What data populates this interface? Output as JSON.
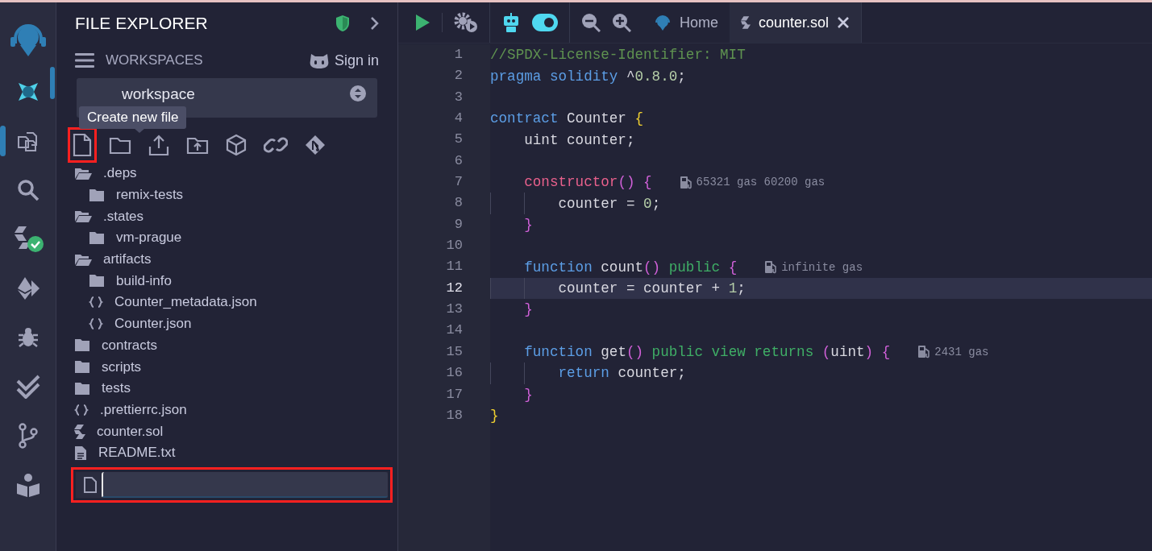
{
  "activity_bar": {
    "items": [
      {
        "kind": "logo",
        "selected": false
      },
      {
        "kind": "ai",
        "selected": false
      },
      {
        "kind": "files",
        "selected": true
      },
      {
        "kind": "search",
        "selected": false
      },
      {
        "kind": "compiler",
        "selected": false
      },
      {
        "kind": "deploy",
        "selected": false
      },
      {
        "kind": "debug",
        "selected": false
      },
      {
        "kind": "tests",
        "selected": false
      },
      {
        "kind": "git",
        "selected": false
      },
      {
        "kind": "learn",
        "selected": false
      }
    ]
  },
  "explorer": {
    "title": "FILE EXPLORER",
    "workspaces_label": "WORKSPACES",
    "sign_in": "Sign in",
    "workspace_select": {
      "value": "workspace"
    },
    "tooltip": "Create new file",
    "toolbar": [
      {
        "kind": "new-file",
        "annotated": true
      },
      {
        "kind": "new-folder",
        "annotated": false
      },
      {
        "kind": "upload",
        "annotated": false
      },
      {
        "kind": "upload-folder",
        "annotated": false
      },
      {
        "kind": "ipfs",
        "annotated": false
      },
      {
        "kind": "link",
        "annotated": false
      },
      {
        "kind": "git",
        "annotated": false
      }
    ],
    "tree": [
      {
        "name": ".deps",
        "kind": "folder",
        "expanded": true,
        "children": [
          {
            "name": "remix-tests",
            "kind": "folder",
            "expanded": false
          }
        ]
      },
      {
        "name": ".states",
        "kind": "folder",
        "expanded": true,
        "children": [
          {
            "name": "vm-prague",
            "kind": "folder",
            "expanded": false
          }
        ]
      },
      {
        "name": "artifacts",
        "kind": "folder",
        "expanded": true,
        "children": [
          {
            "name": "build-info",
            "kind": "folder",
            "expanded": false
          },
          {
            "name": "Counter_metadata.json",
            "kind": "json"
          },
          {
            "name": "Counter.json",
            "kind": "json"
          }
        ]
      },
      {
        "name": "contracts",
        "kind": "folder",
        "expanded": false
      },
      {
        "name": "scripts",
        "kind": "folder",
        "expanded": false
      },
      {
        "name": "tests",
        "kind": "folder",
        "expanded": false
      },
      {
        "name": ".prettierrc.json",
        "kind": "json"
      },
      {
        "name": "counter.sol",
        "kind": "sol"
      },
      {
        "name": "README.txt",
        "kind": "text"
      }
    ],
    "new_file_input": {
      "annotated": true
    }
  },
  "topbar": {
    "toggle_on": true,
    "tabs": [
      {
        "label": "Home",
        "kind": "home",
        "selected": false
      },
      {
        "label": "counter.sol",
        "kind": "sol",
        "selected": true
      }
    ]
  },
  "editor": {
    "lines": [
      {
        "number": "1",
        "current": false,
        "tokens": [
          {
            "t": "//SPDX-License-Identifier: MIT",
            "kind": "comment"
          }
        ]
      },
      {
        "number": "2",
        "current": false,
        "tokens": [
          {
            "t": "pragma solidity",
            "kind": "keyword"
          },
          {
            "t": " ^",
            "kind": "plain"
          },
          {
            "t": "0.8.0",
            "kind": "number"
          },
          {
            "t": ";",
            "kind": "plain"
          }
        ]
      },
      {
        "number": "3",
        "current": false
      },
      {
        "number": "4",
        "current": false,
        "tokens": [
          {
            "t": "contract",
            "kind": "keyword"
          },
          {
            "t": " Counter ",
            "kind": "plain"
          },
          {
            "t": "{",
            "kind": "brace1"
          }
        ]
      },
      {
        "number": "5",
        "current": false,
        "tokens": [
          {
            "t": "    uint counter;",
            "kind": "plain"
          }
        ]
      },
      {
        "number": "6",
        "current": false
      },
      {
        "number": "7",
        "current": false,
        "tokens": [
          {
            "t": "    constructor",
            "kind": "special"
          },
          {
            "t": "() {",
            "kind": "brace2"
          }
        ],
        "gas": "65321 gas 60200 gas"
      },
      {
        "number": "8",
        "current": false,
        "tokens": [
          {
            "t": "        counter = ",
            "kind": "plain"
          },
          {
            "t": "0",
            "kind": "number"
          },
          {
            "t": ";",
            "kind": "plain"
          }
        ]
      },
      {
        "number": "9",
        "current": false,
        "tokens": [
          {
            "t": "    }",
            "kind": "brace2"
          }
        ]
      },
      {
        "number": "10",
        "current": false
      },
      {
        "number": "11",
        "current": false,
        "tokens": [
          {
            "t": "    function",
            "kind": "keyword"
          },
          {
            "t": " count",
            "kind": "plain"
          },
          {
            "t": "()",
            "kind": "brace2"
          },
          {
            "t": " public ",
            "kind": "modifier"
          },
          {
            "t": "{",
            "kind": "brace2"
          }
        ],
        "gas": "infinite gas"
      },
      {
        "number": "12",
        "current": true,
        "tokens": [
          {
            "t": "        counter = counter + ",
            "kind": "plain"
          },
          {
            "t": "1",
            "kind": "number"
          },
          {
            "t": ";",
            "kind": "plain"
          }
        ]
      },
      {
        "number": "13",
        "current": false,
        "tokens": [
          {
            "t": "    }",
            "kind": "brace2"
          }
        ]
      },
      {
        "number": "14",
        "current": false
      },
      {
        "number": "15",
        "current": false,
        "tokens": [
          {
            "t": "    function",
            "kind": "keyword"
          },
          {
            "t": " get",
            "kind": "plain"
          },
          {
            "t": "()",
            "kind": "brace2"
          },
          {
            "t": " public view returns ",
            "kind": "modifier"
          },
          {
            "t": "(",
            "kind": "brace2"
          },
          {
            "t": "uint",
            "kind": "plain"
          },
          {
            "t": ") {",
            "kind": "brace2"
          }
        ],
        "gas": "2431 gas"
      },
      {
        "number": "16",
        "current": false,
        "tokens": [
          {
            "t": "        return",
            "kind": "keyword"
          },
          {
            "t": " counter;",
            "kind": "plain"
          }
        ]
      },
      {
        "number": "17",
        "current": false,
        "tokens": [
          {
            "t": "    }",
            "kind": "brace2"
          }
        ]
      },
      {
        "number": "18",
        "current": false,
        "tokens": [
          {
            "t": "}",
            "kind": "brace1"
          }
        ]
      }
    ]
  }
}
